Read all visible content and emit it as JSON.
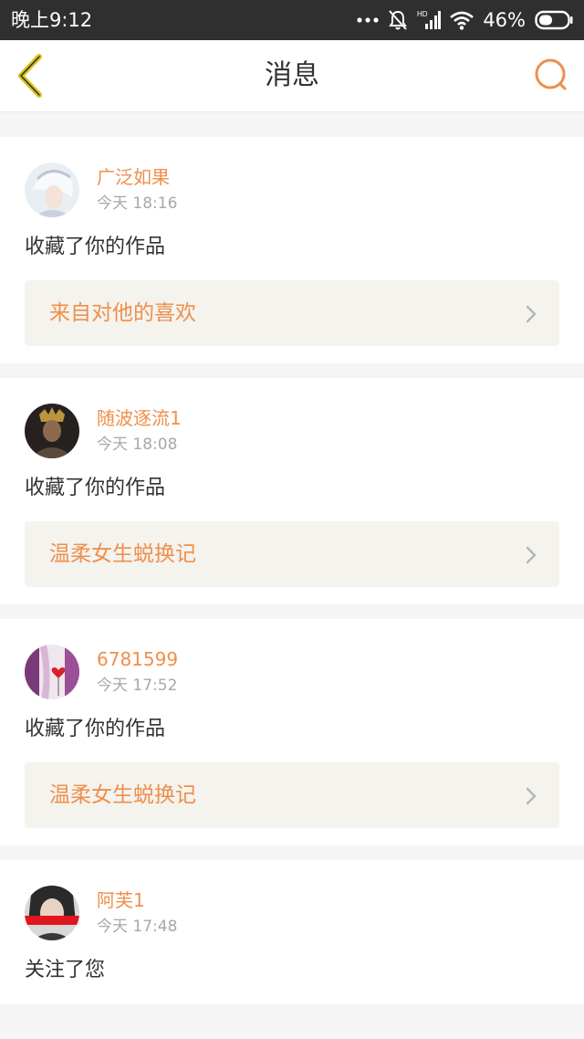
{
  "status_bar": {
    "time": "晚上9:12",
    "battery": "46%",
    "network_label": "HD"
  },
  "header": {
    "title": "消息",
    "back_icon": "chevron-left-icon",
    "search_icon": "search-icon"
  },
  "colors": {
    "accent": "#ef8f4b",
    "back_icon": "#d8c01c",
    "link_bg": "#f4f3ee"
  },
  "messages": [
    {
      "username": "广泛如果",
      "time": "今天 18:16",
      "action": "收藏了你的作品",
      "work": "来自对他的喜欢"
    },
    {
      "username": "随波逐流1",
      "time": "今天 18:08",
      "action": "收藏了你的作品",
      "work": "温柔女生蜕换记"
    },
    {
      "username": "6781599",
      "time": "今天 17:52",
      "action": "收藏了你的作品",
      "work": "温柔女生蜕换记"
    },
    {
      "username": "阿芙1",
      "time": "今天 17:48",
      "action": "关注了您"
    }
  ]
}
